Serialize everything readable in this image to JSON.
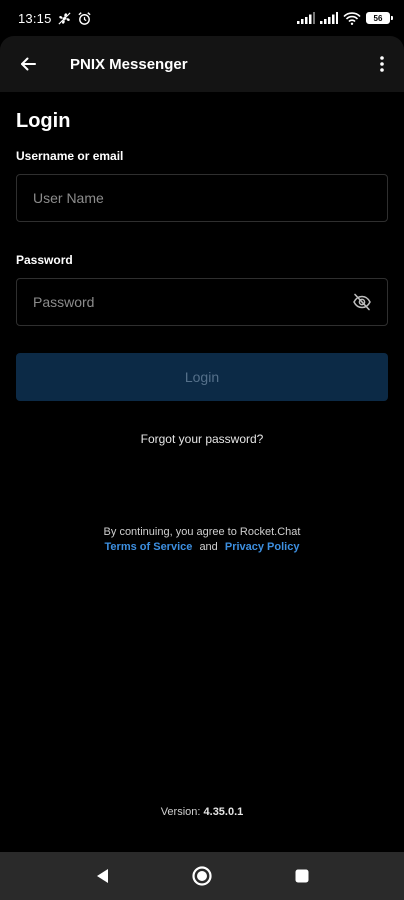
{
  "status_bar": {
    "time": "13:15",
    "battery": "56",
    "icons": [
      "fan-icon",
      "alarm-icon",
      "signal-icon",
      "signal-icon",
      "wifi-icon",
      "battery-icon"
    ]
  },
  "header": {
    "title": "PNIX Messenger",
    "back_icon": "arrow-left-icon",
    "menu_icon": "more-vertical-icon"
  },
  "login": {
    "heading": "Login",
    "username_label": "Username or email",
    "username_placeholder": "User Name",
    "username_value": "",
    "password_label": "Password",
    "password_placeholder": "Password",
    "password_value": "",
    "button_label": "Login",
    "forgot_label": "Forgot your password?"
  },
  "terms": {
    "prefix": "By continuing, you agree to Rocket.Chat",
    "terms_link": "Terms of Service",
    "and": "and",
    "privacy_link": "Privacy Policy"
  },
  "version": {
    "label": "Version:",
    "number": "4.35.0.1"
  },
  "colors": {
    "background": "#000000",
    "header": "#141414",
    "button_disabled": "#0c2a46",
    "link": "#3d8fe0",
    "nav_bar": "#2a2a2a"
  },
  "nav_bar": {
    "icons": [
      "back-triangle-icon",
      "home-circle-icon",
      "recents-square-icon"
    ]
  }
}
